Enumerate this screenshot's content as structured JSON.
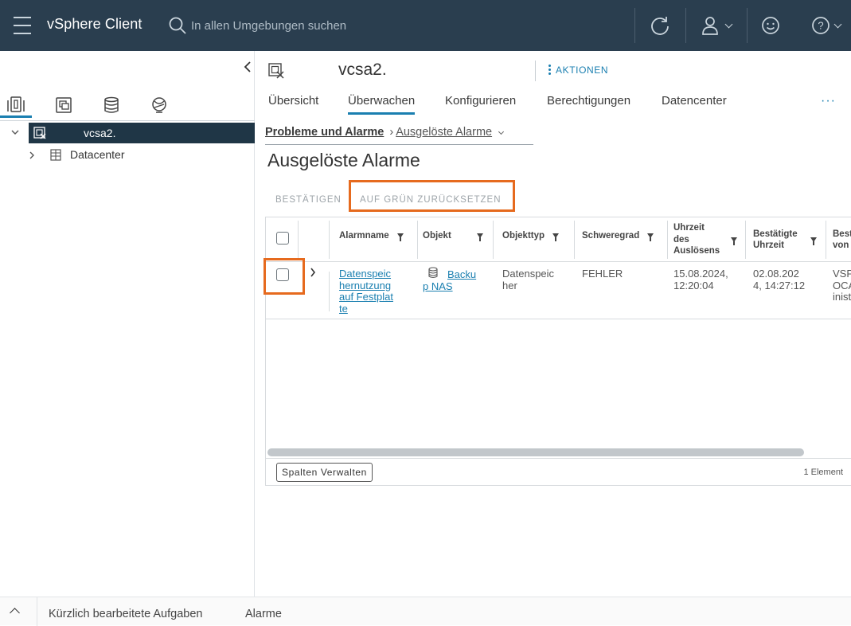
{
  "topbar": {
    "app_title": "vSphere Client",
    "search_placeholder": "In allen Umgebungen suchen"
  },
  "nav_tree": [
    {
      "label": "vcsa2.",
      "selected": true
    },
    {
      "label": "Datacenter",
      "selected": false
    }
  ],
  "object": {
    "title": "vcsa2.",
    "actions_label": "AKTIONEN"
  },
  "tabs": [
    "Übersicht",
    "Überwachen",
    "Konfigurieren",
    "Berechtigungen",
    "Datencenter"
  ],
  "more_tabs": "···",
  "breadcrumb": {
    "parent": "Probleme und Alarme",
    "current": "Ausgelöste Alarme"
  },
  "page_title": "Ausgelöste Alarme",
  "toolbar": {
    "acknowledge": "BESTÄTIGEN",
    "reset_green": "AUF GRÜN ZURÜCKSETZEN"
  },
  "grid": {
    "columns": {
      "alarm_name": "Alarmname",
      "object": "Objekt",
      "object_type": "Objekttyp",
      "severity": "Schweregrad",
      "trigger_time": [
        "Uhrzeit",
        "des",
        "Auslösens"
      ],
      "ack_time": [
        "Bestätigte",
        "Uhrzeit"
      ],
      "ack_by": [
        "Best",
        "von"
      ]
    },
    "row": {
      "alarm_name": [
        "Datenspeic",
        "hernutzung",
        "auf Festplat",
        "te"
      ],
      "object": [
        "Backu",
        "p NAS"
      ],
      "object_type": [
        "Datenspeic",
        "her"
      ],
      "severity": "FEHLER",
      "trigger_time": [
        "15.08.2024,",
        "12:20:04"
      ],
      "ack_time": [
        "02.08.202",
        "4, 14:27:12"
      ],
      "ack_by": [
        "VSP",
        "OCA",
        "inist"
      ]
    },
    "manage_columns": "Spalten Verwalten",
    "item_count": "1 Element"
  },
  "bottombar": {
    "recent_tasks": "Kürzlich bearbeitete Aufgaben",
    "alarms": "Alarme"
  },
  "colors": {
    "header_bg": "#2a3e4f",
    "accent": "#1a7fb0",
    "highlight": "#e66a1e",
    "selected_bg": "#1f3646"
  }
}
